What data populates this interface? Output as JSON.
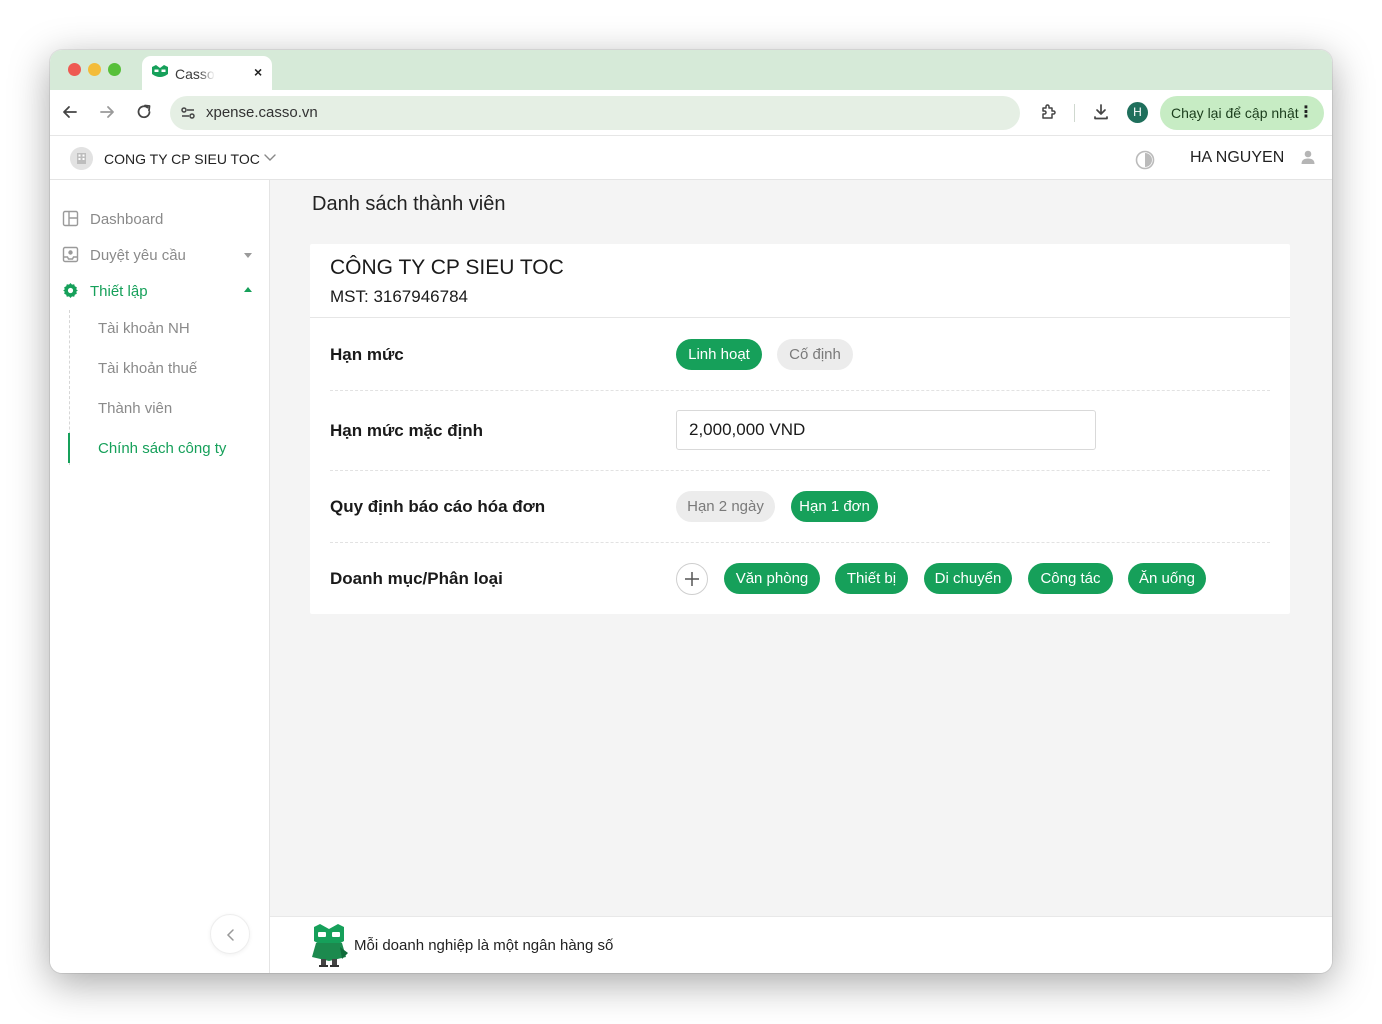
{
  "browser": {
    "tab_title": "Casso",
    "tab_close": "×",
    "url": "xpense.casso.vn",
    "profile_initial": "H",
    "update_label": "Chạy lại để cập nhật",
    "update_menu": "⋮"
  },
  "header": {
    "company_name": "CONG TY CP SIEU TOC",
    "user_name": "HA NGUYEN"
  },
  "sidebar": {
    "items": [
      {
        "label": "Dashboard",
        "icon": "dashboard-icon"
      },
      {
        "label": "Duyệt yêu cầu",
        "icon": "approval-icon"
      },
      {
        "label": "Thiết lập",
        "icon": "gear-icon"
      }
    ],
    "sub_items": [
      {
        "label": "Tài khoản NH"
      },
      {
        "label": "Tài khoản thuế"
      },
      {
        "label": "Thành viên"
      },
      {
        "label": "Chính sách công ty"
      }
    ]
  },
  "main": {
    "page_title": "Danh sách thành viên",
    "company_title": "CÔNG TY CP SIEU TOC",
    "mst": "MST: 3167946784",
    "limit": {
      "label": "Hạn mức",
      "options": [
        "Linh hoạt",
        "Cố định"
      ],
      "selected": "Linh hoạt"
    },
    "default_limit": {
      "label": "Hạn mức mặc định",
      "value": "2,000,000 VND"
    },
    "invoice_rule": {
      "label": "Quy định báo cáo hóa đơn",
      "options": [
        "Hạn 2 ngày",
        "Hạn 1 đơn"
      ],
      "selected": "Hạn 1 đơn"
    },
    "categories": {
      "label": "Doanh mục/Phân loại",
      "items": [
        "Văn phòng",
        "Thiết bị",
        "Di chuyển",
        "Công tác",
        "Ăn uống"
      ]
    }
  },
  "footer": {
    "slogan": "Mỗi doanh nghiệp là một ngân hàng số"
  },
  "colors": {
    "accent": "#16a05a",
    "tabstrip": "#d6ead8",
    "main_bg": "#f4f4f4"
  }
}
